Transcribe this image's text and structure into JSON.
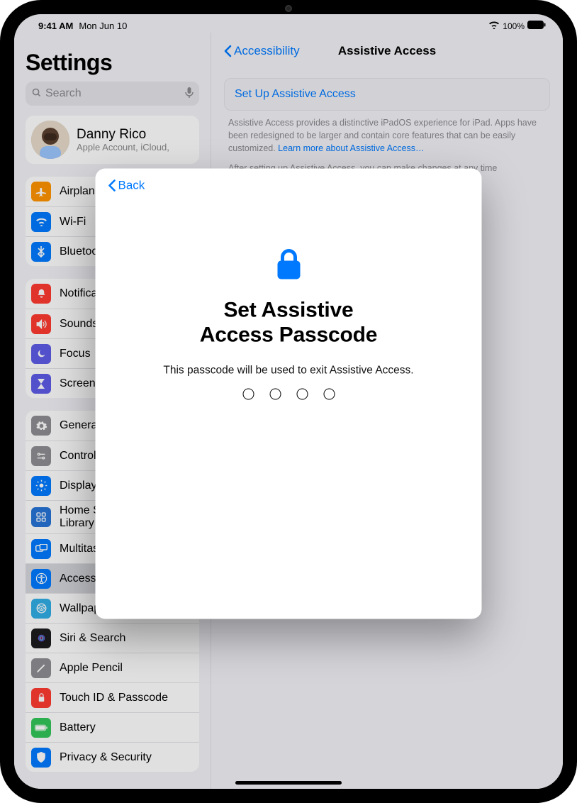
{
  "status": {
    "time": "9:41 AM",
    "date": "Mon Jun 10",
    "battery": "100%"
  },
  "sidebar": {
    "title": "Settings",
    "search_placeholder": "Search",
    "account": {
      "name": "Danny Rico",
      "sub": "Apple Account, iCloud,"
    },
    "g1": [
      {
        "label": "Airplane Mode",
        "icon": "airplane",
        "color": "c-orange"
      },
      {
        "label": "Wi-Fi",
        "icon": "wifi",
        "color": "c-blue"
      },
      {
        "label": "Bluetooth",
        "icon": "bt",
        "color": "c-blue"
      }
    ],
    "g2": [
      {
        "label": "Notifications",
        "icon": "bell",
        "color": "c-red"
      },
      {
        "label": "Sounds",
        "icon": "sound",
        "color": "c-red"
      },
      {
        "label": "Focus",
        "icon": "moon",
        "color": "c-indigo"
      },
      {
        "label": "Screen Time",
        "icon": "hourglass",
        "color": "c-indigo"
      }
    ],
    "g3": [
      {
        "label": "General",
        "icon": "gear",
        "color": "c-gray"
      },
      {
        "label": "Control Center",
        "icon": "cc",
        "color": "c-gray"
      },
      {
        "label": "Display & Brightness",
        "icon": "display",
        "color": "c-blue"
      },
      {
        "label": "Home Screen & App Library",
        "icon": "home",
        "color": "c-dblue"
      },
      {
        "label": "Multitasking & Gestures",
        "icon": "multi",
        "color": "c-blue"
      },
      {
        "label": "Accessibility",
        "icon": "access",
        "color": "c-blue",
        "selected": true
      },
      {
        "label": "Wallpaper",
        "icon": "wall",
        "color": "c-cyan"
      },
      {
        "label": "Siri & Search",
        "icon": "siri",
        "color": "c-black"
      },
      {
        "label": "Apple Pencil",
        "icon": "pencil",
        "color": "c-gray"
      },
      {
        "label": "Touch ID & Passcode",
        "icon": "touchid",
        "color": "c-red"
      },
      {
        "label": "Battery",
        "icon": "batt",
        "color": "c-green"
      },
      {
        "label": "Privacy & Security",
        "icon": "privacy",
        "color": "c-blue"
      }
    ]
  },
  "detail": {
    "back_label": "Accessibility",
    "title": "Assistive Access",
    "setup_label": "Set Up Assistive Access",
    "caption1": "Assistive Access provides a distinctive iPadOS experience for iPad. Apps have been redesigned to be larger and contain core features that can be easily customized. ",
    "caption_link": "Learn more about Assistive Access…",
    "caption2": "After setting up Assistive Access, you can make changes at any time"
  },
  "modal": {
    "back": "Back",
    "title_line1": "Set Assistive",
    "title_line2": "Access Passcode",
    "desc": "This passcode will be used to exit Assistive Access."
  }
}
